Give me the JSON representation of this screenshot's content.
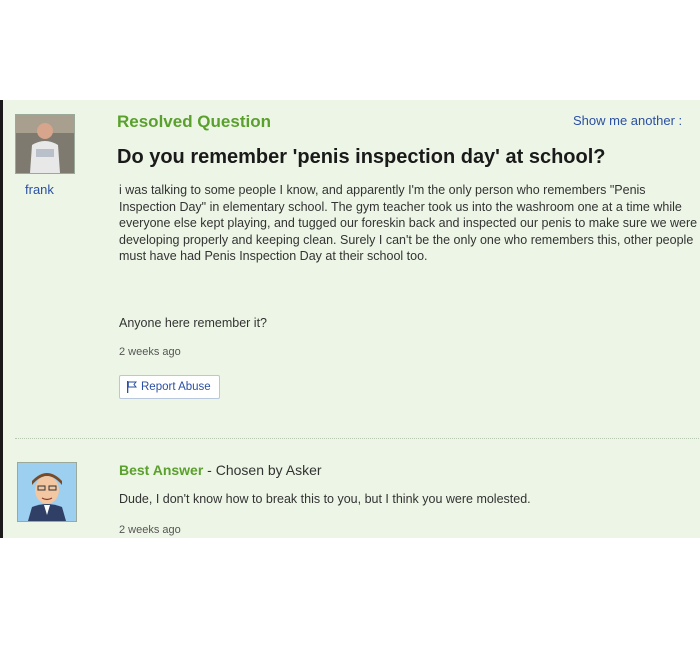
{
  "header": {
    "status_label": "Resolved Question",
    "show_another_label": "Show me another :"
  },
  "asker": {
    "name": "frank",
    "avatar_icon": "user-photo-avatar"
  },
  "question": {
    "title": "Do you remember 'penis inspection day' at school?",
    "body": "i was talking to some people I know, and apparently I'm the only person who remembers \"Penis Inspection Day\" in elementary school. The gym teacher took us into the washroom one at a time while everyone else kept playing, and tugged our foreskin back and inspected our penis to make sure we were developing properly and keeping clean. Surely I can't be the only one who remembers this, other people must have had Penis Inspection Day at their school too.",
    "followup": "Anyone here remember it?",
    "time": "2 weeks ago",
    "report_label": "Report Abuse",
    "report_icon": "flag-icon"
  },
  "answer": {
    "best_label": "Best Answer",
    "chosen_by": " - Chosen by Asker",
    "body": "Dude, I don't know how to break this to you, but I think you were molested.",
    "time": "2 weeks ago",
    "avatar_icon": "cartoon-avatar"
  },
  "colors": {
    "accent_green": "#5aa02c",
    "link_blue": "#2b4fa3",
    "panel_bg": "#edf6e6"
  }
}
